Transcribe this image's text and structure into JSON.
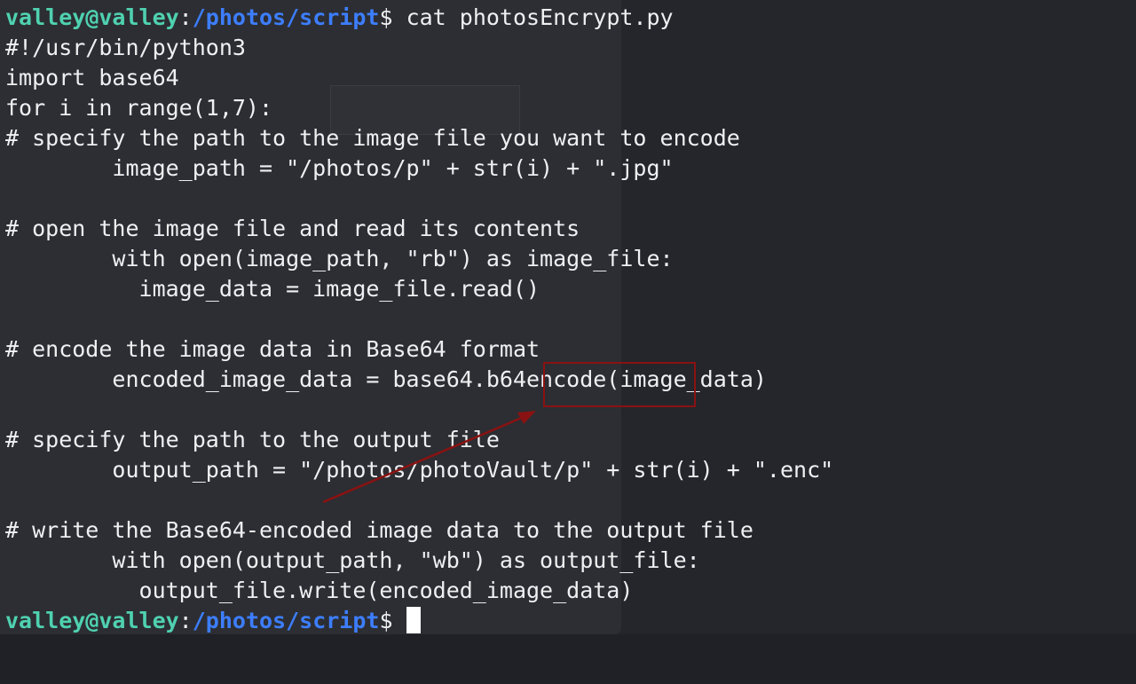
{
  "prompt": {
    "user": "valley@valley",
    "colon": ":",
    "path": "/photos/script",
    "dollar": "$"
  },
  "command": " cat photosEncrypt.py",
  "code_lines": [
    "#!/usr/bin/python3",
    "import base64",
    "for i in range(1,7):",
    "# specify the path to the image file you want to encode",
    "        image_path = \"/photos/p\" + str(i) + \".jpg\"",
    "",
    "# open the image file and read its contents",
    "        with open(image_path, \"rb\") as image_file:",
    "          image_data = image_file.read()",
    "",
    "# encode the image data in Base64 format",
    "        encoded_image_data = base64.b64encode(image_data)",
    "",
    "# specify the path to the output file",
    "        output_path = \"/photos/photoVault/p\" + str(i) + \".enc\"",
    "",
    "# write the Base64-encoded image data to the output file",
    "        with open(output_path, \"wb\") as output_file:",
    "          output_file.write(encoded_image_data)"
  ],
  "colors": {
    "background": "#24262b",
    "prompt_user": "#4fd1b0",
    "prompt_path": "#3d7eff",
    "annotation": "#8a1212"
  },
  "annotation": {
    "target_text": "b64encode(",
    "shape": "rectangle-with-arrow"
  }
}
